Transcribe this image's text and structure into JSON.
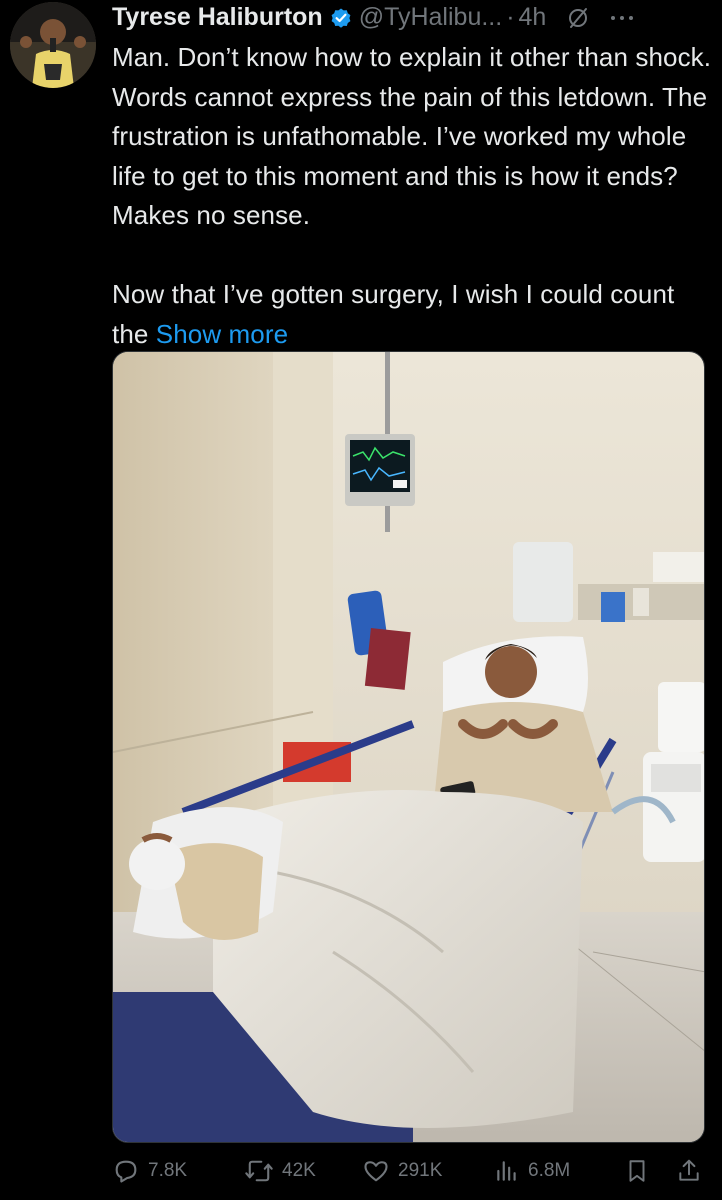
{
  "author": {
    "display_name": "Tyrese Haliburton",
    "handle": "@TyHalibu...",
    "separator": "·",
    "time": "4h",
    "verified_icon": "verified-badge-icon",
    "avatar_icon": "profile-photo"
  },
  "tweet": {
    "text": "Man. Don’t know how to explain it other than shock. Words cannot express the pain of this letdown. The frustration is unfathomable. I’ve worked my whole life to get to this moment and this is how it ends? Makes no sense.\n\nNow that I’ve gotten surgery, I wish I could count the ",
    "show_more": "Show more",
    "media_description_icon": "hospital-photo"
  },
  "actions": {
    "replies": "7.8K",
    "reposts": "42K",
    "likes": "291K",
    "views": "6.8M"
  },
  "colors": {
    "background": "#000000",
    "text": "#e7e9ea",
    "muted": "#71767b",
    "link": "#1d9bf0",
    "verified": "#1d9bf0"
  }
}
